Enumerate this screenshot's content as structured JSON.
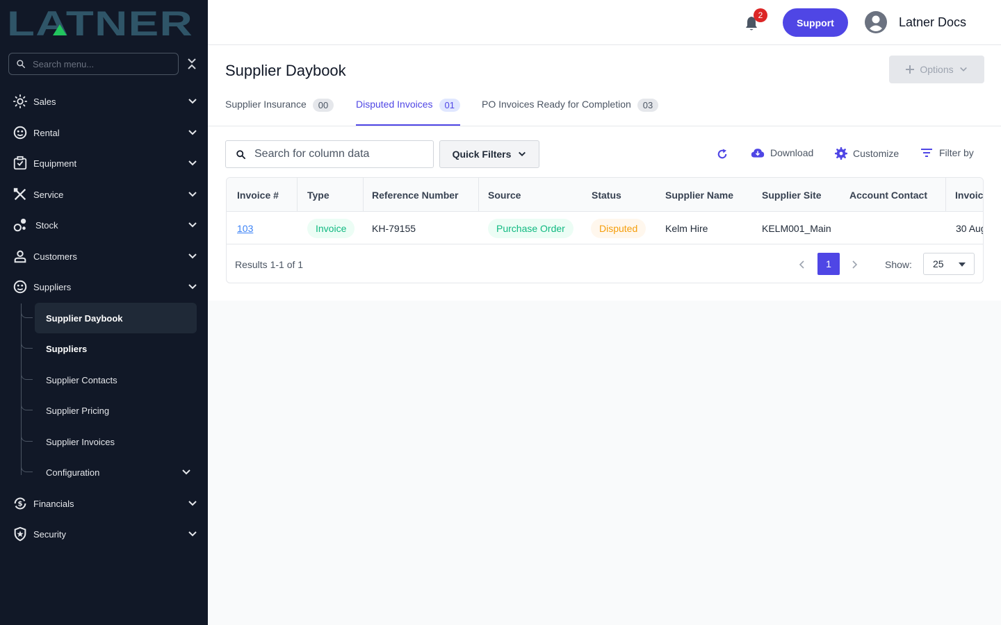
{
  "brand": {
    "logo_text": "LATNER"
  },
  "sidebar": {
    "search_placeholder": "Search menu...",
    "items": [
      {
        "label": "Sales"
      },
      {
        "label": "Rental"
      },
      {
        "label": "Equipment"
      },
      {
        "label": "Service"
      },
      {
        "label": "Stock"
      },
      {
        "label": "Customers"
      },
      {
        "label": "Suppliers"
      },
      {
        "label": "Financials"
      },
      {
        "label": "Security"
      }
    ],
    "supplier_sub": [
      {
        "label": "Supplier Daybook"
      },
      {
        "label": "Suppliers"
      },
      {
        "label": "Supplier Contacts"
      },
      {
        "label": "Supplier Pricing"
      },
      {
        "label": "Supplier Invoices"
      },
      {
        "label": "Configuration"
      }
    ]
  },
  "header": {
    "notification_count": "2",
    "support_label": "Support",
    "user_name": "Latner Docs"
  },
  "page": {
    "title": "Supplier Daybook",
    "options_label": "Options",
    "tabs": [
      {
        "label": "Supplier Insurance",
        "count": "00"
      },
      {
        "label": "Disputed Invoices",
        "count": "01"
      },
      {
        "label": "PO Invoices Ready for Completion",
        "count": "03"
      }
    ]
  },
  "toolbar": {
    "search_placeholder": "Search for column data",
    "quick_filters_label": "Quick Filters",
    "download_label": "Download",
    "customize_label": "Customize",
    "filter_label": "Filter by"
  },
  "table": {
    "columns": [
      "Invoice #",
      "Type",
      "Reference Number",
      "Source",
      "Status",
      "Supplier Name",
      "Supplier Site",
      "Account Contact",
      "Invoic"
    ],
    "rows": [
      {
        "invoice": "103",
        "type": "Invoice",
        "reference": "KH-79155",
        "source": "Purchase Order",
        "status": "Disputed",
        "supplier_name": "Kelm Hire",
        "supplier_site": "KELM001_Main",
        "account_contact": "",
        "invoice_date": "30 Aug"
      }
    ],
    "results_text": "Results 1-1 of 1",
    "current_page": "1",
    "show_label": "Show:",
    "page_size": "25"
  },
  "colors": {
    "sidebar_bg": "#111827",
    "accent": "#4f46e5",
    "logo": "#2f5568",
    "logo_accent": "#22c55e",
    "type_pill": "#10b981",
    "status_pill": "#f59e0b"
  }
}
